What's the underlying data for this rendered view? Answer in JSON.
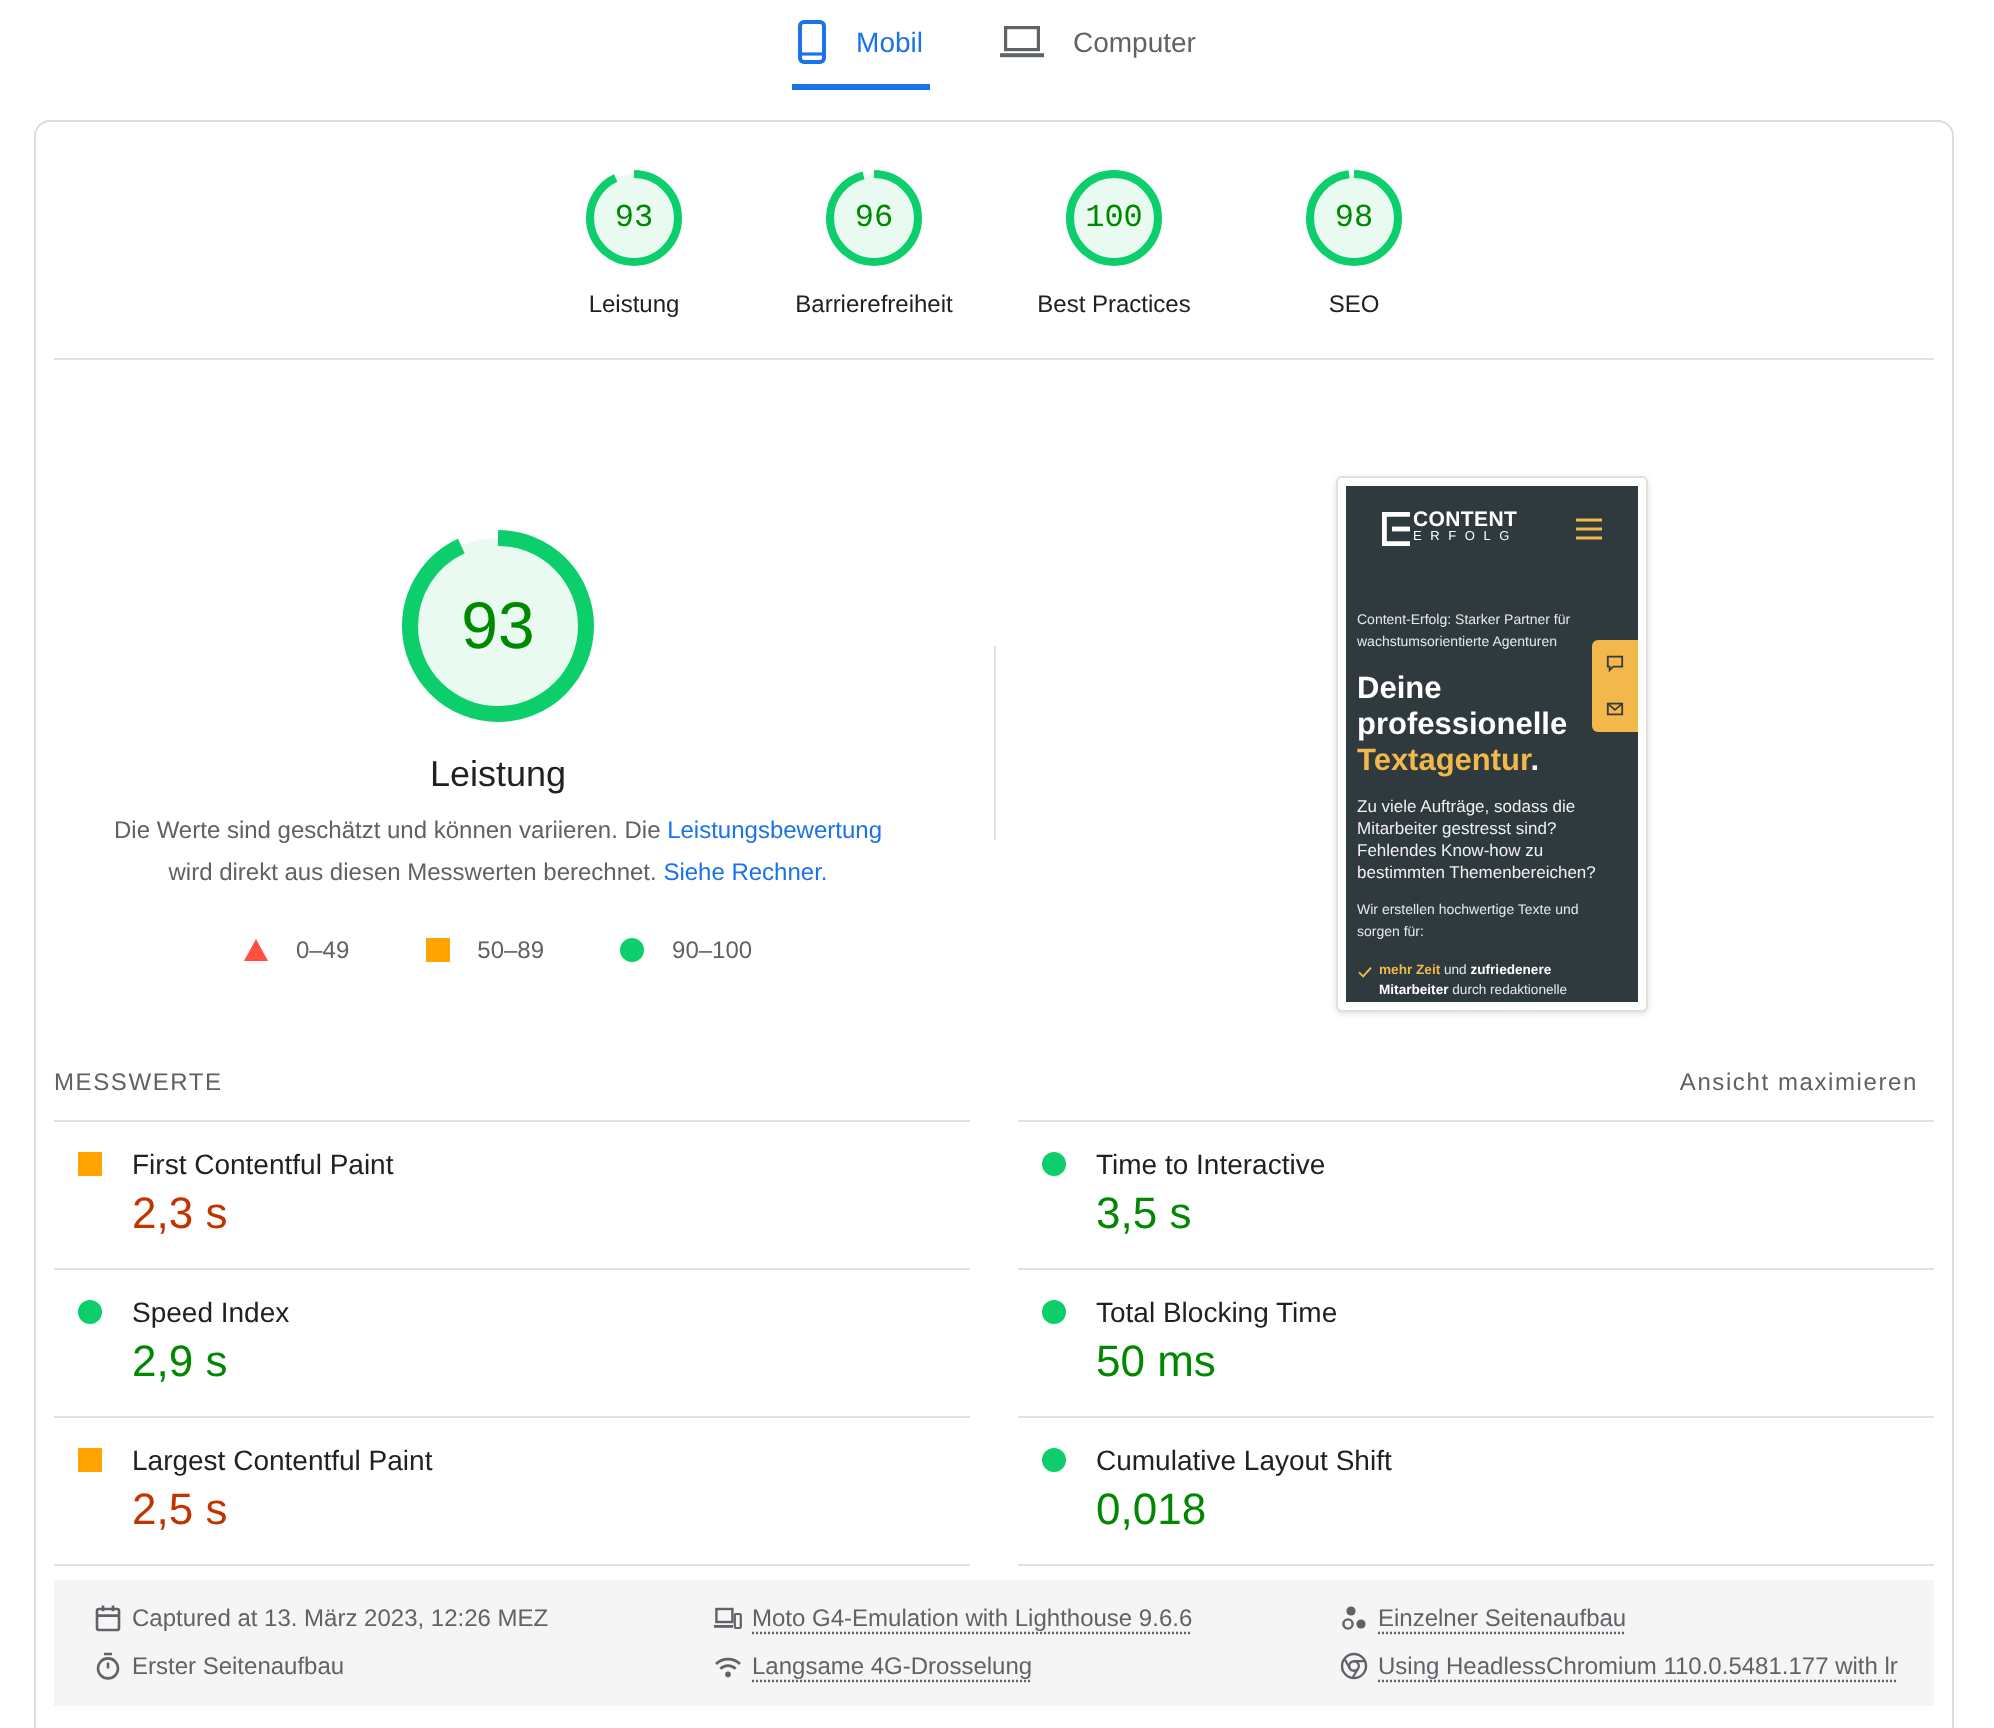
{
  "device_tabs": [
    {
      "kind": "phone",
      "label": "Mobil",
      "selected": true
    },
    {
      "kind": "laptop",
      "label": "Computer",
      "selected": false
    }
  ],
  "category_scores": [
    {
      "score": "93",
      "label": "Leistung",
      "level": 0.93
    },
    {
      "score": "96",
      "label": "Barrierefreiheit",
      "level": 0.96
    },
    {
      "score": "100",
      "label": "Best Practices",
      "level": 1
    },
    {
      "score": "98",
      "label": "SEO",
      "level": 0.98
    }
  ],
  "performance": {
    "score": "93",
    "level": 0.93,
    "title": "Leistung",
    "description": [
      {
        "kind": "text",
        "text": "Die Werte sind geschätzt und können variieren. Die "
      },
      {
        "kind": "link",
        "text": "Leistungsbewertung"
      },
      {
        "kind": "text",
        "text": " wird direkt aus diesen Messwerten berechnet. "
      },
      {
        "kind": "link",
        "text": "Siehe Rechner."
      }
    ],
    "legend": [
      {
        "kind": "fail",
        "range": "0–49"
      },
      {
        "kind": "average",
        "range": "50–89"
      },
      {
        "kind": "pass",
        "range": "90–100"
      }
    ]
  },
  "screenshot": {
    "logo": {
      "top": "CONTENT",
      "bottom": "ERFOLG"
    },
    "tagline": "Content-Erfolg: Starker Partner für wachstumsorientierte Agenturen",
    "headline": [
      {
        "kind": "plain",
        "text": "Deine professionelle "
      },
      {
        "kind": "accent",
        "text": "Textagentur"
      },
      {
        "kind": "plain",
        "text": "."
      }
    ],
    "intro": "Zu viele Aufträge, sodass die Mitarbeiter gestresst sind? Fehlendes Know-how zu bestimmten Themenbereichen?",
    "lead": "Wir erstellen hochwertige Texte und sorgen für:",
    "bullets": [
      {
        "parts": [
          {
            "kind": "accent",
            "text": "mehr Zeit"
          },
          {
            "kind": "plain",
            "text": " und "
          },
          {
            "kind": "bold",
            "text": "zufriedenere Mitarbeiter"
          },
          {
            "kind": "plain",
            "text": " durch redaktionelle"
          }
        ]
      }
    ]
  },
  "metrics": {
    "title": "MESSWERTE",
    "toggle": "Ansicht maximieren",
    "items": [
      {
        "name": "First Contentful Paint",
        "value": "2,3 s",
        "kind": "average"
      },
      {
        "name": "Time to Interactive",
        "value": "3,5 s",
        "kind": "pass"
      },
      {
        "name": "Speed Index",
        "value": "2,9 s",
        "kind": "pass"
      },
      {
        "name": "Total Blocking Time",
        "value": "50 ms",
        "kind": "pass"
      },
      {
        "name": "Largest Contentful Paint",
        "value": "2,5 s",
        "kind": "average"
      },
      {
        "name": "Cumulative Layout Shift",
        "value": "0,018",
        "kind": "pass"
      }
    ]
  },
  "footer": {
    "items": [
      {
        "kind": "date",
        "text": "Captured at 13. März 2023, 12:26 MEZ",
        "link": false
      },
      {
        "kind": "device",
        "text": "Moto G4-Emulation with Lighthouse 9.6.6",
        "link": true
      },
      {
        "kind": "single-run",
        "text": "Einzelner Seitenaufbau",
        "link": true
      },
      {
        "kind": "first-load",
        "text": "Erster Seitenaufbau",
        "link": false
      },
      {
        "kind": "throttling",
        "text": "Langsame 4G-Drosselung",
        "link": true
      },
      {
        "kind": "browser",
        "text": "Using HeadlessChromium 110.0.5481.177 with lr",
        "link": true
      }
    ]
  }
}
